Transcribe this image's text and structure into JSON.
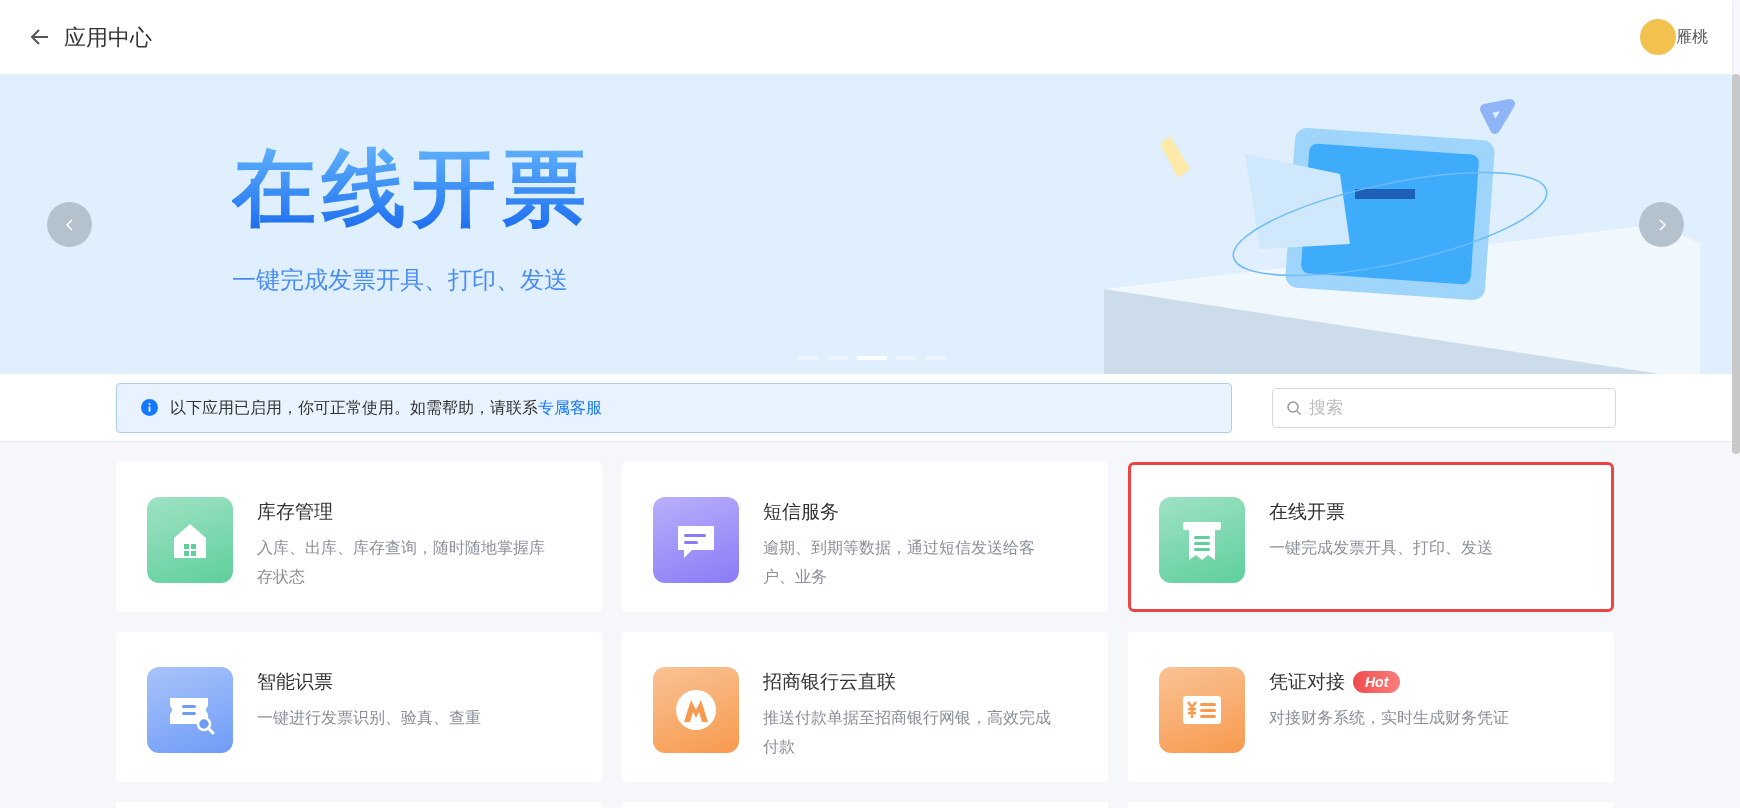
{
  "header": {
    "title": "应用中心",
    "user_name": "雁桃"
  },
  "banner": {
    "title": "在线开票",
    "subtitle": "一键完成发票开具、打印、发送",
    "dots": [
      {
        "selected": false
      },
      {
        "selected": false
      },
      {
        "selected": true
      },
      {
        "selected": false
      },
      {
        "selected": false
      }
    ]
  },
  "notice": {
    "text": "以下应用已启用，你可正常使用。如需帮助，请联系",
    "link": "专属客服"
  },
  "search": {
    "placeholder": "搜索"
  },
  "apps": [
    {
      "name": "库存管理",
      "description": "入库、出库、库存查询，随时随地掌握库存状态",
      "kind": "house",
      "color": "#5fcf9c",
      "selected": false
    },
    {
      "name": "短信服务",
      "description": "逾期、到期等数据，通过短信发送给客户、业务",
      "kind": "message",
      "color": "#8a7bf7",
      "selected": false
    },
    {
      "name": "在线开票",
      "description": "一键完成发票开具、打印、发送",
      "kind": "receipt",
      "color": "#5fcf9c",
      "selected": true
    },
    {
      "name": "智能识票",
      "description": "一键进行发票识别、验真、查重",
      "kind": "ticket",
      "color": "#6f9cf7",
      "selected": false
    },
    {
      "name": "招商银行云直联",
      "description": "推送付款单据至招商银行网银，高效完成付款",
      "kind": "bank",
      "color": "#f79a4e",
      "selected": false
    },
    {
      "name": "凭证对接",
      "description": "对接财务系统，实时生成财务凭证",
      "kind": "voucher",
      "color": "#f79a4e",
      "selected": false,
      "badge": "Hot"
    }
  ]
}
